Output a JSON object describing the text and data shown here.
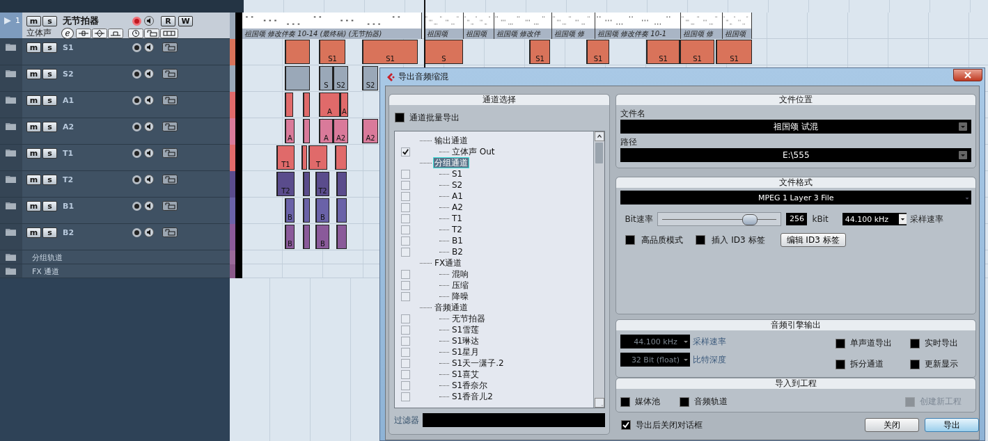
{
  "tracks": [
    {
      "kind": "audio",
      "number": "1",
      "name": "无节拍器",
      "channel": "立体声",
      "selected": true,
      "record_armed": true,
      "color": "#9aa8b8",
      "mute_label": "m",
      "solo_label": "s",
      "read_label": "R",
      "write_label": "W",
      "edit_label": "e",
      "parts": [
        "祖国颂 修改伴奏 10-14 (最终稿) (无节拍器)",
        "祖国颂",
        "祖国颂",
        "祖国颂 修改伴",
        "祖国颂 修",
        "祖国颂 修改伴奏 10-1",
        "祖国颂 修",
        "祖国颂"
      ]
    },
    {
      "kind": "folder",
      "name": "S1",
      "selected": false,
      "record_armed": false,
      "color": "#d9735a",
      "mute_label": "m",
      "solo_label": "s",
      "clips": [
        "S1",
        "S1",
        "S",
        "S1",
        "S1",
        "S1",
        "S1",
        "S1"
      ]
    },
    {
      "kind": "folder",
      "name": "S2",
      "selected": false,
      "record_armed": false,
      "color": "#9aa8b8",
      "mute_label": "m",
      "solo_label": "s",
      "clips": [
        "S",
        "S2",
        "S2"
      ]
    },
    {
      "kind": "folder",
      "name": "A1",
      "selected": false,
      "record_armed": false,
      "color": "#e06a6a",
      "mute_label": "m",
      "solo_label": "s",
      "clips": [
        "A",
        "A"
      ]
    },
    {
      "kind": "folder",
      "name": "A2",
      "selected": false,
      "record_armed": false,
      "color": "#d97a9a",
      "mute_label": "m",
      "solo_label": "s",
      "clips": [
        "A",
        "A",
        "A2",
        "A2"
      ]
    },
    {
      "kind": "folder",
      "name": "T1",
      "selected": false,
      "record_armed": false,
      "color": "#e06a6a",
      "mute_label": "m",
      "solo_label": "s",
      "clips": [
        "T1",
        "T"
      ]
    },
    {
      "kind": "folder",
      "name": "T2",
      "selected": false,
      "record_armed": false,
      "color": "#5a4c8c",
      "mute_label": "m",
      "solo_label": "s",
      "clips": [
        "T2",
        "T2"
      ]
    },
    {
      "kind": "folder",
      "name": "B1",
      "selected": false,
      "record_armed": false,
      "color": "#6a62a8",
      "mute_label": "m",
      "solo_label": "s",
      "clips": [
        "B",
        "B"
      ]
    },
    {
      "kind": "folder",
      "name": "B2",
      "selected": false,
      "record_armed": false,
      "color": "#8a5a9a",
      "mute_label": "m",
      "solo_label": "s",
      "clips": [
        "B",
        "B"
      ]
    },
    {
      "kind": "group",
      "name": "分组轨道",
      "selected": false,
      "color": "#9a6a9a"
    },
    {
      "kind": "group",
      "name": "FX 通道",
      "selected": false,
      "color": "#8a5a8a"
    }
  ],
  "dialog": {
    "title": "导出音频缩混",
    "channel_panel": {
      "title": "通道选择",
      "batch_export": {
        "label": "通道批量导出",
        "checked": false
      },
      "tree": [
        {
          "label": "输出通道",
          "selected": false,
          "children": [
            {
              "label": "立体声 Out",
              "checked": true,
              "selected": false
            }
          ]
        },
        {
          "label": "分组通道",
          "selected": true,
          "children": [
            {
              "label": "S1",
              "checked": false,
              "selected": false
            },
            {
              "label": "S2",
              "checked": false,
              "selected": false
            },
            {
              "label": "A1",
              "checked": false,
              "selected": false
            },
            {
              "label": "A2",
              "checked": false,
              "selected": false
            },
            {
              "label": "T1",
              "checked": false,
              "selected": false
            },
            {
              "label": "T2",
              "checked": false,
              "selected": false
            },
            {
              "label": "B1",
              "checked": false,
              "selected": false
            },
            {
              "label": "B2",
              "checked": false,
              "selected": false
            }
          ]
        },
        {
          "label": "FX通道",
          "selected": false,
          "children": [
            {
              "label": "混响",
              "checked": false,
              "selected": false
            },
            {
              "label": "压缩",
              "checked": false,
              "selected": false
            },
            {
              "label": "降噪",
              "checked": false,
              "selected": false
            }
          ]
        },
        {
          "label": "音频通道",
          "selected": false,
          "children": [
            {
              "label": "无节拍器",
              "checked": false,
              "selected": false
            },
            {
              "label": "S1雪莲",
              "checked": false,
              "selected": false
            },
            {
              "label": "S1琳达",
              "checked": false,
              "selected": false
            },
            {
              "label": "S1星月",
              "checked": false,
              "selected": false
            },
            {
              "label": "S1天一潇子.2",
              "checked": false,
              "selected": false
            },
            {
              "label": "S1喜艾",
              "checked": false,
              "selected": false
            },
            {
              "label": "S1香奈尔",
              "checked": false,
              "selected": false
            },
            {
              "label": "S1香音儿2",
              "checked": false,
              "selected": false
            }
          ]
        }
      ],
      "filter": {
        "label": "过滤器"
      }
    },
    "file_location": {
      "title": "文件位置",
      "file_name": {
        "label": "文件名",
        "value": "祖国颂 试混"
      },
      "path": {
        "label": "路径",
        "value": "E:\\555"
      }
    },
    "file_format": {
      "title": "文件格式",
      "format": "MPEG 1 Layer 3 File",
      "bitrate": {
        "label": "Bit速率",
        "level": 0.75,
        "value": "256",
        "unit": "kBit"
      },
      "sample_rate": {
        "value": "44.100 kHz",
        "label": "采样速率"
      },
      "options": [
        {
          "label": "高品质模式",
          "checked": false
        },
        {
          "label": "插入 ID3 标签",
          "checked": false
        }
      ],
      "edit_button": "编辑 ID3 标签"
    },
    "engine_output": {
      "title": "音频引擎输出",
      "selects": [
        {
          "value": "44.100 kHz",
          "label": "采样速率"
        },
        {
          "value": "32 Bit (float)",
          "label": "比特深度"
        }
      ],
      "options": [
        {
          "label": "单声道导出",
          "checked": false
        },
        {
          "label": "实时导出",
          "checked": false
        },
        {
          "label": "拆分通道",
          "checked": false
        },
        {
          "label": "更新显示",
          "checked": false
        }
      ]
    },
    "import_to_project": {
      "title": "导入到工程",
      "options": [
        {
          "label": "媒体池",
          "checked": false,
          "disabled": false
        },
        {
          "label": "音频轨道",
          "checked": false,
          "disabled": false
        },
        {
          "label": "创建新工程",
          "checked": false,
          "disabled": true
        }
      ]
    },
    "close_after_export": {
      "label": "导出后关闭对话框",
      "checked": true
    },
    "buttons": [
      {
        "label": "关闭",
        "default": false
      },
      {
        "label": "导出",
        "default": true
      }
    ]
  }
}
